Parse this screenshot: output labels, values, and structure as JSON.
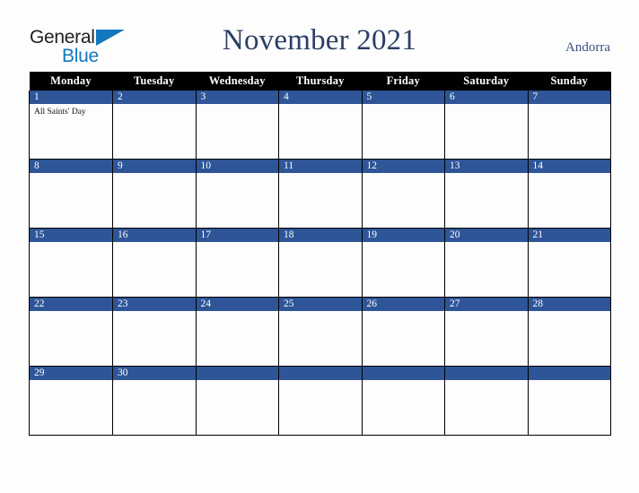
{
  "logo": {
    "word_one": "General",
    "word_two": "Blue",
    "triangle_icon": "blue-triangle-icon",
    "color_dark": "#221f1f",
    "color_blue": "#1278be"
  },
  "header": {
    "title": "November 2021",
    "country": "Andorra",
    "title_color": "#2b3f66",
    "country_color": "#3c5180"
  },
  "calendar": {
    "weekday_headers": [
      "Monday",
      "Tuesday",
      "Wednesday",
      "Thursday",
      "Friday",
      "Saturday",
      "Sunday"
    ],
    "header_bg": "#010101",
    "header_text_color": "#ffffff",
    "daynum_band_color": "#2e5597",
    "grid_line_color": "#000000",
    "cell_bg": "#fdfdfd",
    "weeks": [
      {
        "days": [
          {
            "number": "1",
            "events": [
              "All Saints' Day"
            ]
          },
          {
            "number": "2",
            "events": []
          },
          {
            "number": "3",
            "events": []
          },
          {
            "number": "4",
            "events": []
          },
          {
            "number": "5",
            "events": []
          },
          {
            "number": "6",
            "events": []
          },
          {
            "number": "7",
            "events": []
          }
        ]
      },
      {
        "days": [
          {
            "number": "8",
            "events": []
          },
          {
            "number": "9",
            "events": []
          },
          {
            "number": "10",
            "events": []
          },
          {
            "number": "11",
            "events": []
          },
          {
            "number": "12",
            "events": []
          },
          {
            "number": "13",
            "events": []
          },
          {
            "number": "14",
            "events": []
          }
        ]
      },
      {
        "days": [
          {
            "number": "15",
            "events": []
          },
          {
            "number": "16",
            "events": []
          },
          {
            "number": "17",
            "events": []
          },
          {
            "number": "18",
            "events": []
          },
          {
            "number": "19",
            "events": []
          },
          {
            "number": "20",
            "events": []
          },
          {
            "number": "21",
            "events": []
          }
        ]
      },
      {
        "days": [
          {
            "number": "22",
            "events": []
          },
          {
            "number": "23",
            "events": []
          },
          {
            "number": "24",
            "events": []
          },
          {
            "number": "25",
            "events": []
          },
          {
            "number": "26",
            "events": []
          },
          {
            "number": "27",
            "events": []
          },
          {
            "number": "28",
            "events": []
          }
        ]
      },
      {
        "days": [
          {
            "number": "29",
            "events": []
          },
          {
            "number": "30",
            "events": []
          },
          {
            "number": "",
            "events": []
          },
          {
            "number": "",
            "events": []
          },
          {
            "number": "",
            "events": []
          },
          {
            "number": "",
            "events": []
          },
          {
            "number": "",
            "events": []
          }
        ]
      }
    ]
  }
}
